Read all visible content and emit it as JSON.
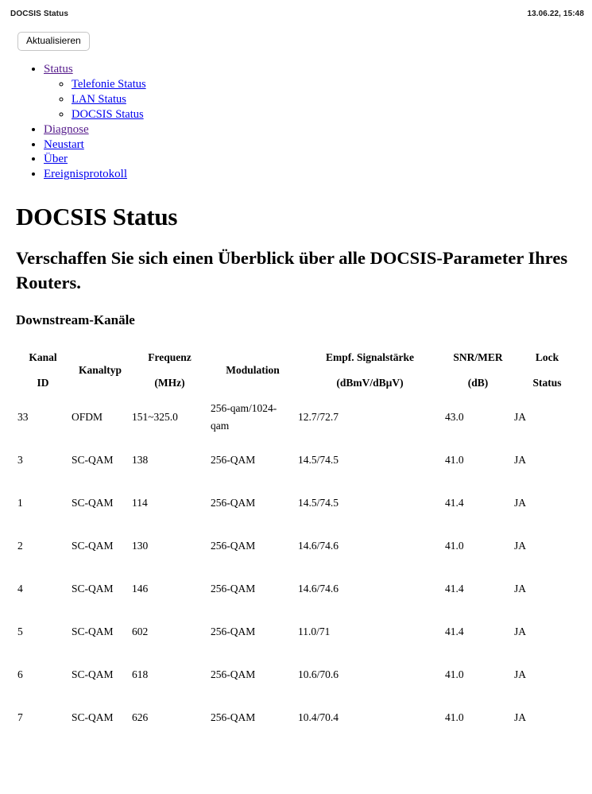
{
  "header": {
    "title": "DOCSIS Status",
    "timestamp": "13.06.22, 15:48"
  },
  "toolbar": {
    "refresh_label": "Aktualisieren"
  },
  "nav": {
    "items": [
      {
        "label": "Status",
        "state": "visited"
      },
      {
        "label": "Diagnose",
        "state": "visited"
      },
      {
        "label": "Neustart",
        "state": "link"
      },
      {
        "label": "Über",
        "state": "link"
      },
      {
        "label": "Ereignisprotokoll",
        "state": "link"
      }
    ],
    "subitems": [
      {
        "label": "Telefonie Status",
        "state": "link"
      },
      {
        "label": "LAN Status",
        "state": "link"
      },
      {
        "label": "DOCSIS Status",
        "state": "link"
      }
    ]
  },
  "main": {
    "page_title": "DOCSIS Status",
    "subtitle": "Verschaffen Sie sich einen Überblick über alle DOCSIS-Parameter Ihres Routers.",
    "section_title": "Downstream-Kanäle"
  },
  "table": {
    "headers": [
      {
        "line1": "Kanal",
        "line2": "ID"
      },
      {
        "line1": "Kanaltyp",
        "line2": ""
      },
      {
        "line1": "Frequenz",
        "line2": "(MHz)"
      },
      {
        "line1": "Modulation",
        "line2": ""
      },
      {
        "line1": "Empf. Signalstärke",
        "line2": "(dBmV/dBµV)"
      },
      {
        "line1": "SNR/MER",
        "line2": "(dB)"
      },
      {
        "line1": "Lock",
        "line2": "Status"
      }
    ],
    "rows": [
      {
        "id": "33",
        "type": "OFDM",
        "frequency": "151~325.0",
        "modulation": "256-qam/1024-qam",
        "signal": "12.7/72.7",
        "snr": "43.0",
        "lock": "JA"
      },
      {
        "id": "3",
        "type": "SC-QAM",
        "frequency": "138",
        "modulation": "256-QAM",
        "signal": "14.5/74.5",
        "snr": "41.0",
        "lock": "JA"
      },
      {
        "id": "1",
        "type": "SC-QAM",
        "frequency": "114",
        "modulation": "256-QAM",
        "signal": "14.5/74.5",
        "snr": "41.4",
        "lock": "JA"
      },
      {
        "id": "2",
        "type": "SC-QAM",
        "frequency": "130",
        "modulation": "256-QAM",
        "signal": "14.6/74.6",
        "snr": "41.0",
        "lock": "JA"
      },
      {
        "id": "4",
        "type": "SC-QAM",
        "frequency": "146",
        "modulation": "256-QAM",
        "signal": "14.6/74.6",
        "snr": "41.4",
        "lock": "JA"
      },
      {
        "id": "5",
        "type": "SC-QAM",
        "frequency": "602",
        "modulation": "256-QAM",
        "signal": "11.0/71",
        "snr": "41.4",
        "lock": "JA"
      },
      {
        "id": "6",
        "type": "SC-QAM",
        "frequency": "618",
        "modulation": "256-QAM",
        "signal": "10.6/70.6",
        "snr": "41.0",
        "lock": "JA"
      },
      {
        "id": "7",
        "type": "SC-QAM",
        "frequency": "626",
        "modulation": "256-QAM",
        "signal": "10.4/70.4",
        "snr": "41.0",
        "lock": "JA"
      }
    ]
  },
  "colors": {
    "link": "#0000ee",
    "visited_link": "#551a8b",
    "text": "#000000",
    "button_border": "#c6c6c6"
  }
}
